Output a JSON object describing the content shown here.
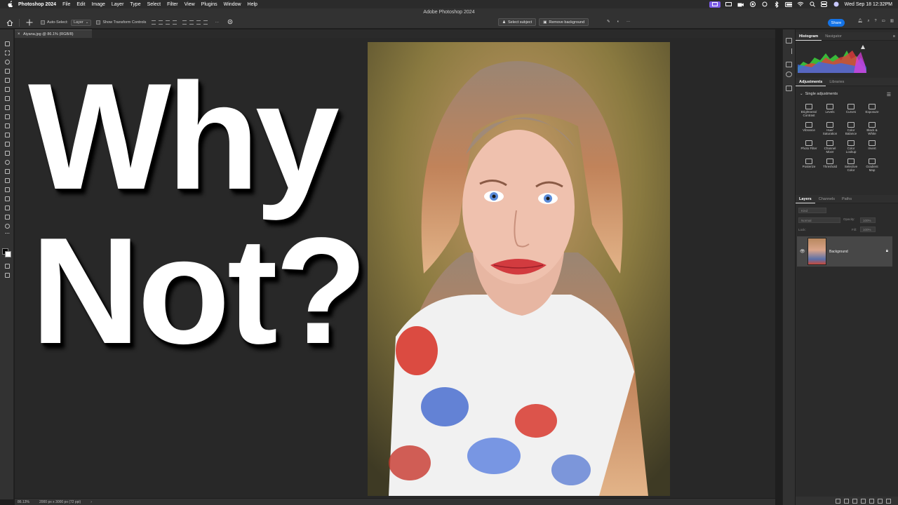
{
  "menubar": {
    "app": "Photoshop 2024",
    "items": [
      "File",
      "Edit",
      "Image",
      "Layer",
      "Type",
      "Select",
      "Filter",
      "View",
      "Plugins",
      "Window",
      "Help"
    ],
    "datetime": "Wed Sep 18  12:32PM"
  },
  "window": {
    "title": "Adobe Photoshop 2024"
  },
  "options": {
    "auto_select": "Auto-Select:",
    "layer_select": "Layer",
    "transform": "Show Transform Controls",
    "select_subject": "Select subject",
    "remove_bg": "Remove background",
    "share": "Share",
    "more": "···"
  },
  "document": {
    "tab": "Aiyana.jpg @ 86.1% (RGB/8)"
  },
  "canvas": {
    "line1": "Why",
    "line2": "Not?"
  },
  "status": {
    "zoom": "86.13%",
    "info": "2000 px x 3000 px (72 ppi)",
    "arrow": "›"
  },
  "panels": {
    "histogram_tab": "Histogram",
    "navigator_tab": "Navigator",
    "adjustments_tab": "Adjustments",
    "libraries_tab": "Libraries",
    "single_adj": "Single adjustments",
    "adjustments": [
      "Brightness/\nContrast",
      "Levels",
      "Curves",
      "Exposure",
      "Vibrance",
      "Hue/\nSaturation",
      "Color\nBalance",
      "Black &\nWhite",
      "Photo Filter",
      "Channel\nMixer",
      "Color\nLookup",
      "Invert",
      "Posterize",
      "Threshold",
      "Selective\nColor",
      "Gradient\nMap"
    ],
    "layers_tab": "Layers",
    "channels_tab": "Channels",
    "paths_tab": "Paths",
    "kind": "Kind",
    "blend": "Normal",
    "opacity": "Opacity:",
    "opacity_val": "100%",
    "lock": "Lock:",
    "fill": "Fill:",
    "fill_val": "100%",
    "layer_name": "Background"
  },
  "colors": {
    "accent": "#1473e6",
    "menu_active": "#7b5ce6"
  }
}
